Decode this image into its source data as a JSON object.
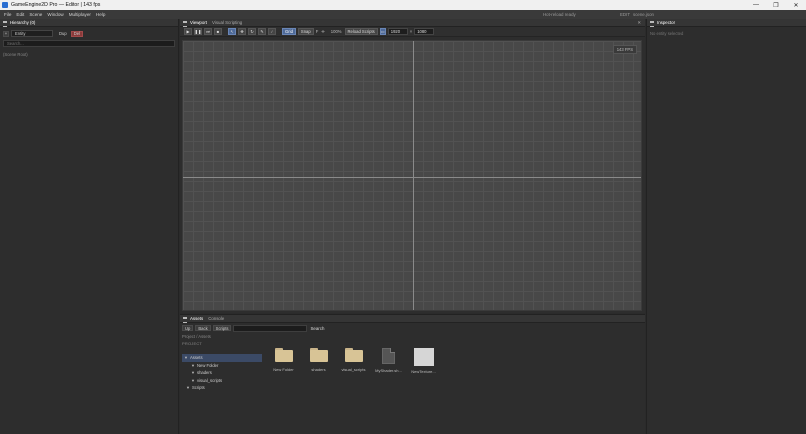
{
  "window": {
    "title": "GameEngine2D Pro — Editor  |  143 fps",
    "minimize": "—",
    "maximize": "❐",
    "close": "✕"
  },
  "menu": {
    "items": [
      "File",
      "Edit",
      "Scene",
      "Window",
      "Multiplayer",
      "Help"
    ],
    "status": "Hot-reload ready",
    "edit_mode": "EDIT",
    "scene_file": "scene.json"
  },
  "hierarchy": {
    "title": "Hierarchy (0)",
    "add_label": "+",
    "entity_name": "Entity",
    "dup_label": "Dup",
    "del_label": "Del",
    "search_placeholder": "Search...",
    "scene_label": "(Scene Root)"
  },
  "viewport": {
    "tabs": [
      "Viewport",
      "Visual Scripting"
    ],
    "close_icon": "✕",
    "tools": {
      "play": "▶",
      "pause": "❚❚",
      "step": "⏭",
      "stop": "■",
      "select": "↖",
      "move": "✥",
      "rotate": "↻",
      "brush": "✎",
      "eyedrop": "⁄"
    },
    "grid_label": "Grid",
    "snap_label": "Snap",
    "f_label": "F",
    "center_icon": "✛",
    "zoom": "100%",
    "reload_scripts": "Reload Scripts",
    "res_icon": "▭",
    "width": "1920",
    "height_sep": "×",
    "height": "1080",
    "fps_badge": "143 FPS"
  },
  "inspector": {
    "title": "Inspector",
    "empty": "No entity selected"
  },
  "assets": {
    "tabs": [
      "Assets",
      "Console"
    ],
    "up_label": "Up",
    "back_label": "Back",
    "scripts_label": "Scripts",
    "search_label": "Search",
    "breadcrumb": "Project / Assets",
    "project_label": "PROJECT",
    "tree": [
      {
        "label": "Assets",
        "arrow": "▼"
      },
      {
        "label": "New Folder",
        "arrow": "▼"
      },
      {
        "label": "shaders",
        "arrow": "▼"
      },
      {
        "label": "visual_scripts",
        "arrow": "▼"
      },
      {
        "label": "Scripts",
        "arrow": "▼"
      }
    ],
    "items": [
      {
        "label": "New Folder",
        "kind": "folder"
      },
      {
        "label": "shaders",
        "kind": "folder"
      },
      {
        "label": "visual_scripts",
        "kind": "folder"
      },
      {
        "label": "MyShader.sh...",
        "kind": "file"
      },
      {
        "label": "NewTexture...",
        "kind": "texture"
      }
    ]
  }
}
